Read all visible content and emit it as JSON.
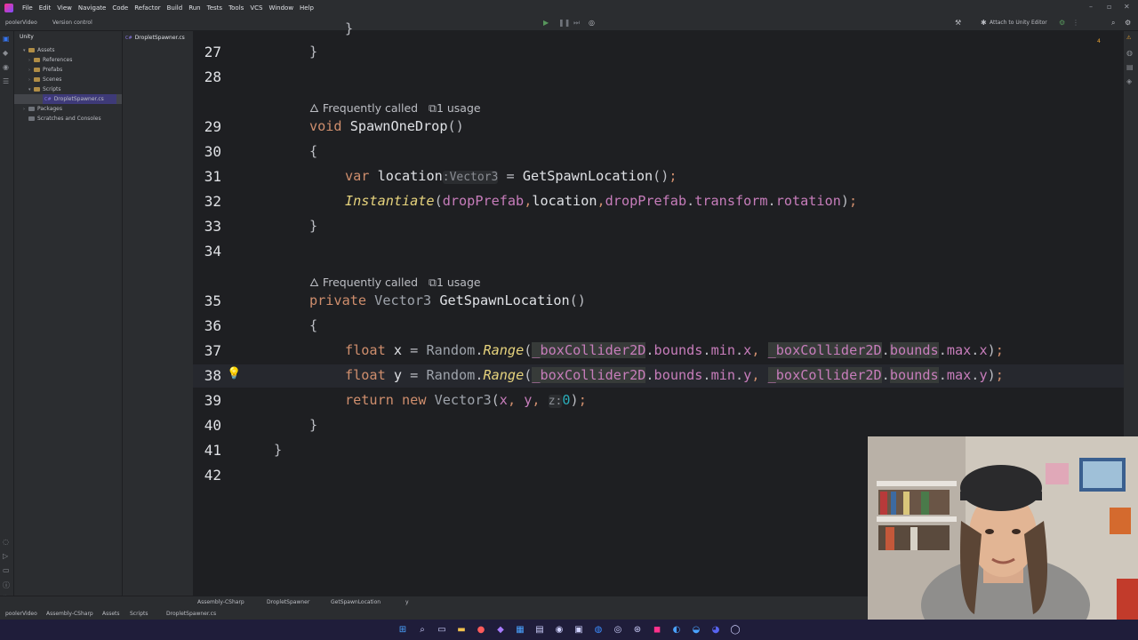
{
  "menu": [
    "File",
    "Edit",
    "View",
    "Navigate",
    "Code",
    "Refactor",
    "Build",
    "Run",
    "Tests",
    "Tools",
    "VCS",
    "Window",
    "Help"
  ],
  "toolbar": {
    "project": "poolerVideo",
    "vcs": "Version control",
    "attach": "Attach to Unity Editor",
    "warnings": "4"
  },
  "project_panel": {
    "title": "Unity",
    "items": [
      {
        "label": "Assets",
        "kind": "folder"
      },
      {
        "label": "References",
        "kind": "folder"
      },
      {
        "label": "Prefabs",
        "kind": "folder"
      },
      {
        "label": "Scenes",
        "kind": "folder"
      },
      {
        "label": "Scripts",
        "kind": "folder"
      },
      {
        "label": "DropletSpawner.cs",
        "kind": "file"
      },
      {
        "label": "Packages",
        "kind": "folder"
      },
      {
        "label": "Scratches and Consoles",
        "kind": "folder"
      }
    ]
  },
  "editor": {
    "tab": "DropletSpawner.cs",
    "hint_freq": "Frequently called",
    "hint_usage": "1 usage",
    "param_vec3": "Vector3",
    "param_z": "z:",
    "line_numbers": [
      "27",
      "28",
      "29",
      "30",
      "31",
      "32",
      "33",
      "34",
      "35",
      "36",
      "37",
      "38",
      "39",
      "40",
      "41",
      "42"
    ]
  },
  "status": {
    "crumb1": "Assembly-CSharp",
    "crumb2": "DropletSpawner",
    "crumb3": "GetSpawnLocation",
    "crumb4": "y",
    "path": [
      "poolerVideo",
      "Assembly-CSharp",
      "Assets",
      "Scripts",
      "DropletSpawner.cs"
    ]
  }
}
